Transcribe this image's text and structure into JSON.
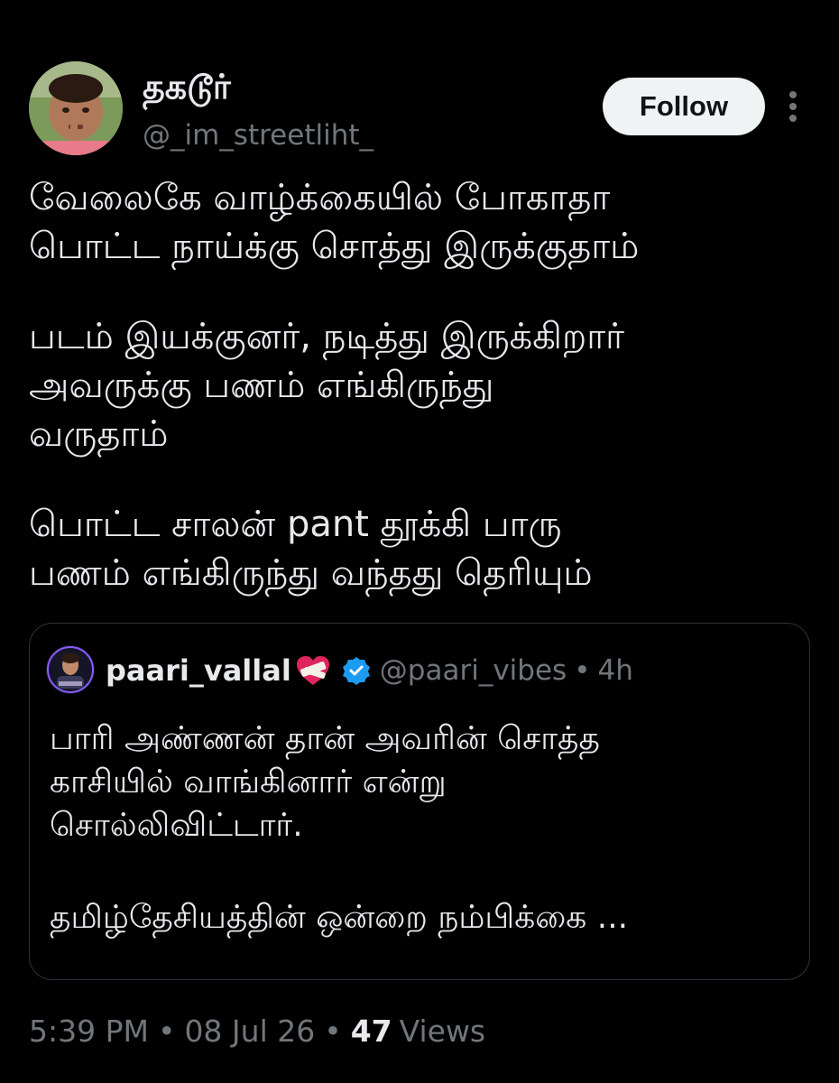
{
  "author": {
    "display_name": "தகடூர்",
    "handle": "@_im_streetliht_",
    "follow_label": "Follow",
    "more_icon": "more-vertical-icon"
  },
  "tweet": {
    "lines": [
      "வேலைகே வாழ்க்கையில் போகாதா",
      "பொட்ட நாய்க்கு சொத்து இருக்குதாம்",
      "",
      "படம் இயக்குனர், நடித்து இருக்கிறார்",
      "அவருக்கு பணம் எங்கிருந்து",
      "வருதாம்",
      "",
      "பொட்ட சாலன் pant தூக்கி பாரு",
      "பணம் எங்கிருந்து வந்தது தெரியும்"
    ]
  },
  "quote": {
    "name": "paari_vallal",
    "heart_icon": "heart-bandage-icon",
    "verified_icon": "verified-badge-icon",
    "handle": "@paari_vibes",
    "separator": "•",
    "time": "4h",
    "lines": [
      "பாரி அண்ணன் தான் அவரின் சொத்த",
      "காசியில் வாங்கினார் என்று",
      "சொல்லிவிட்டார்.",
      "",
      "தமிழ்தேசியத்தின் ஒன்றை நம்பிக்கை ..."
    ]
  },
  "meta": {
    "time": "5:39 PM",
    "separator": "•",
    "date": "08 Jul 26",
    "views_count": "47",
    "views_label": "Views"
  },
  "colors": {
    "background": "#000000",
    "text": "#e7e9ea",
    "secondary": "#71767b",
    "border": "#2f3336",
    "verified": "#1d9bf0",
    "heart": "#f91880"
  }
}
